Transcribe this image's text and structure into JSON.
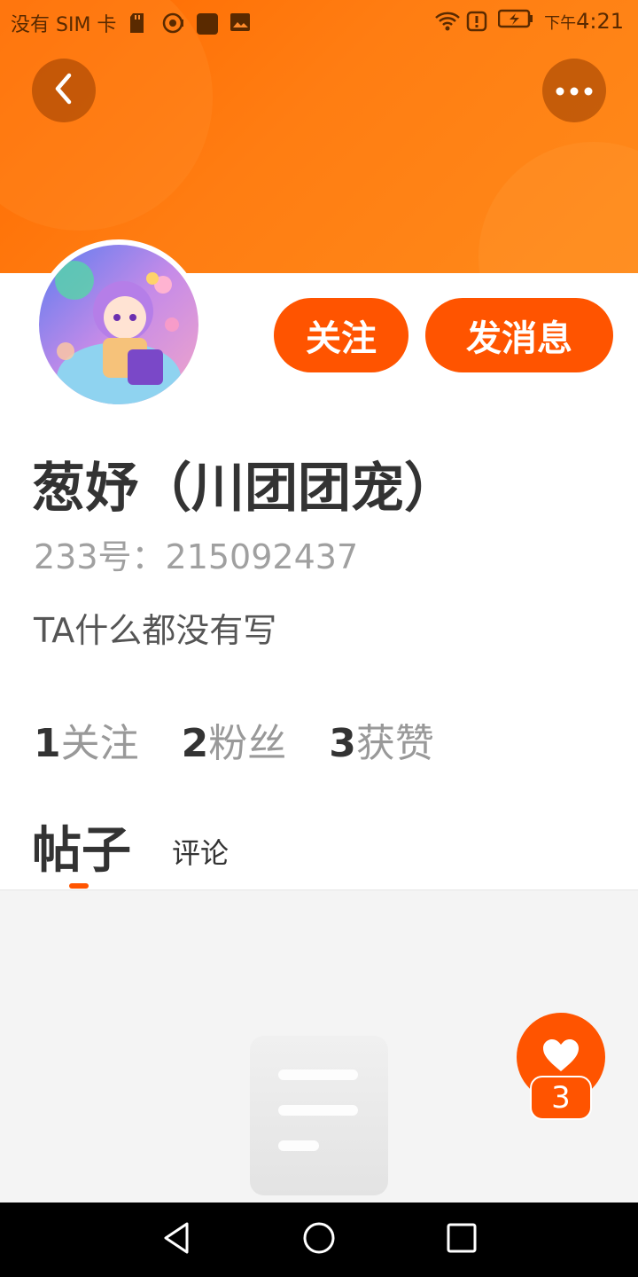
{
  "status_bar": {
    "carrier": "没有 SIM 卡",
    "time_prefix": "下午",
    "time": "4:21",
    "icons": [
      "sd-card-icon",
      "hotspot-icon",
      "app-icon",
      "gallery-icon",
      "wifi-icon",
      "alert-icon",
      "battery-charging-icon"
    ]
  },
  "header": {
    "back_icon": "chevron-left-icon",
    "more_icon": "more-horizontal-icon",
    "banner_color": "#ff7010"
  },
  "profile": {
    "name": "葱妤（川团团宠）",
    "uid": "233号：215092437",
    "bio": "TA什么都没有写",
    "follow_label": "关注",
    "message_label": "发消息",
    "accent_color": "#ff5400"
  },
  "stats": [
    {
      "num": "1",
      "label": "关注"
    },
    {
      "num": "2",
      "label": "粉丝"
    },
    {
      "num": "3",
      "label": "获赞"
    }
  ],
  "tabs": {
    "posts": "帖子",
    "comments": "评论"
  },
  "like_fab": {
    "icon": "heart-icon",
    "count": "3"
  },
  "nav": {
    "back": "back-triangle-icon",
    "home": "home-circle-icon",
    "recents": "recents-square-icon"
  }
}
